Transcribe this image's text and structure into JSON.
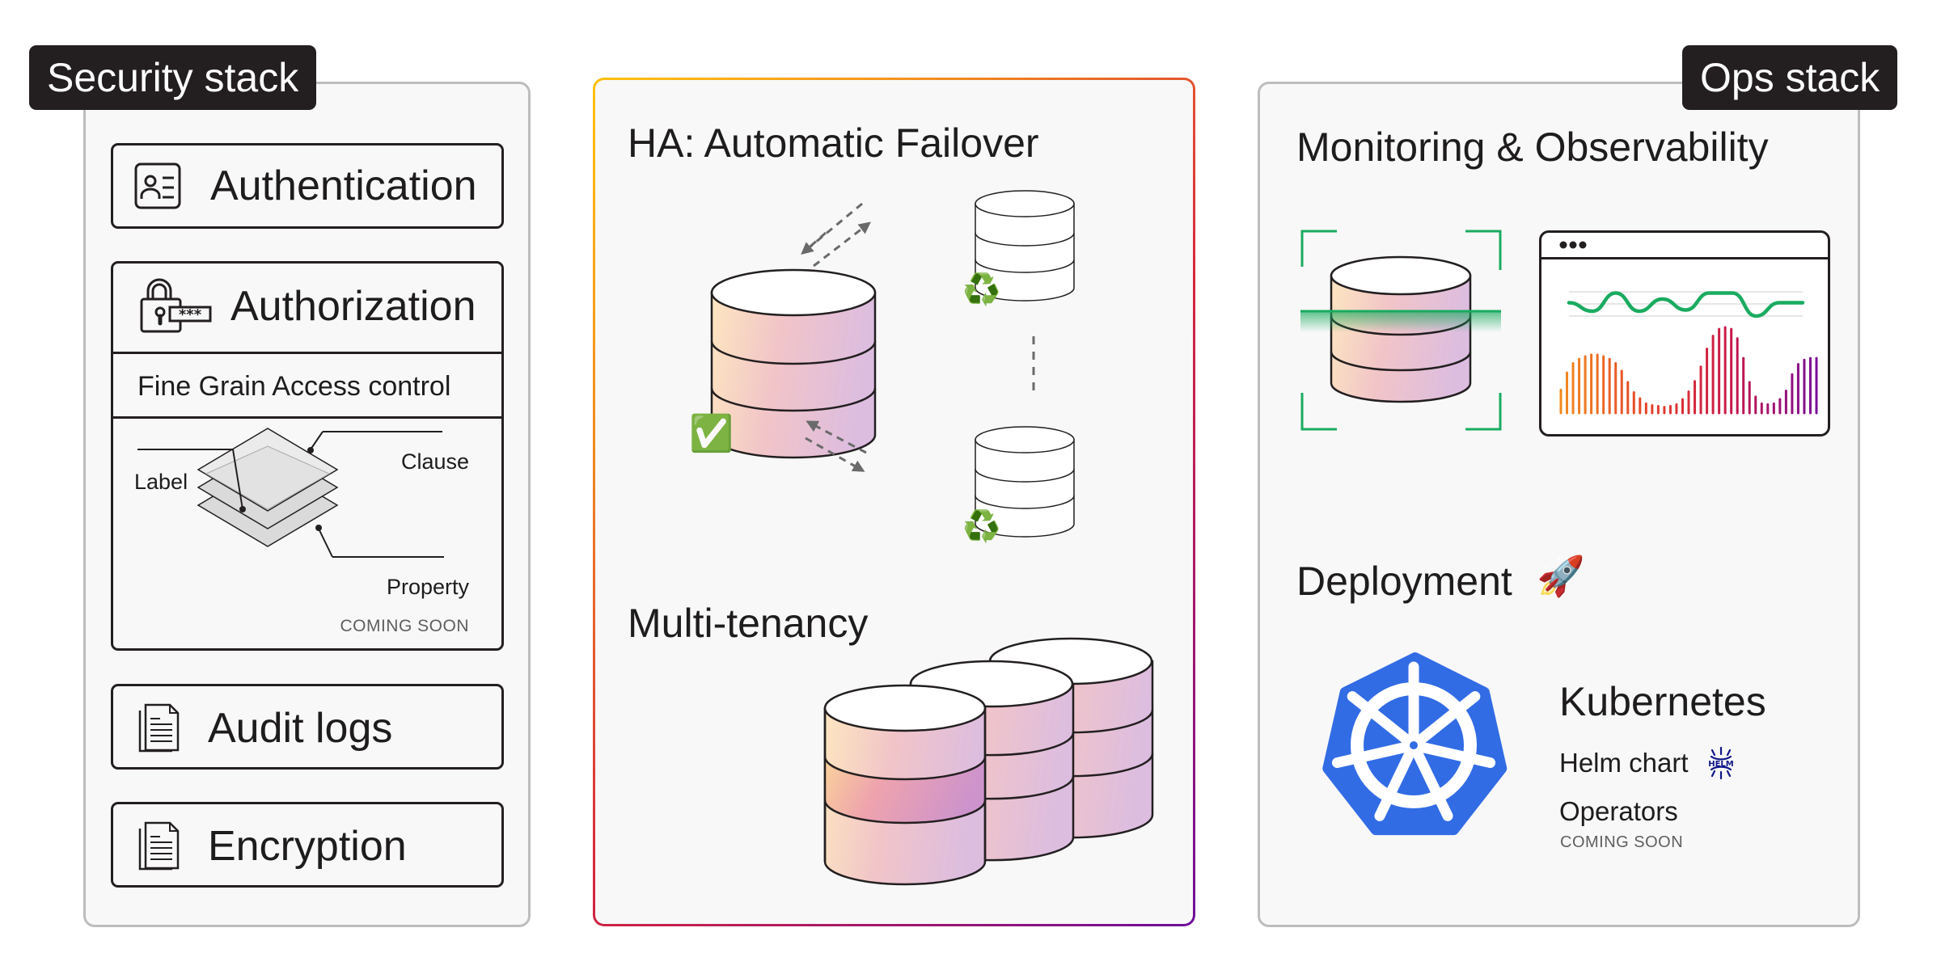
{
  "security": {
    "badge": "Security stack",
    "items": {
      "authentication": "Authentication",
      "authorization": "Authorization",
      "fine_grain": "Fine Grain Access control",
      "audit_logs": "Audit logs",
      "encryption": "Encryption"
    },
    "diagram": {
      "label": "Label",
      "clause": "Clause",
      "property": "Property",
      "coming_soon": "COMING SOON"
    },
    "icons": {
      "authentication": "id-card-icon",
      "authorization": "padlock-password-icon",
      "audit_logs": "documents-icon",
      "encryption": "documents-icon"
    }
  },
  "middle": {
    "ha_title": "HA: Automatic Failover",
    "multitenancy_title": "Multi-tenancy",
    "primary_status_icon": "✅",
    "replica_status_icon": "♻️",
    "gradient_colors": [
      "#ffc20e",
      "#f28a1e",
      "#d7263d",
      "#a0166e",
      "#6f0f9a"
    ]
  },
  "ops": {
    "badge": "Ops stack",
    "monitoring_title": "Monitoring & Observability",
    "deployment_title": "Deployment",
    "deployment_icon": "🚀",
    "kubernetes": "Kubernetes",
    "helm_chart": "Helm chart",
    "helm_logo_text": "HELM",
    "operators": "Operators",
    "operators_status": "COMING SOON",
    "colors": {
      "scan_green": "#1aab60",
      "kubernetes_blue": "#326ce5",
      "helm_navy": "#0f1689"
    },
    "dashboard": {
      "line_values": [
        0.55,
        0.2,
        0.95,
        0.2,
        0.7,
        0.25,
        0.95,
        0.95,
        0.0,
        0.55,
        0.55
      ],
      "bar_values": [
        0.27,
        0.47,
        0.58,
        0.63,
        0.66,
        0.68,
        0.68,
        0.66,
        0.63,
        0.58,
        0.49,
        0.36,
        0.24,
        0.17,
        0.11,
        0.09,
        0.08,
        0.07,
        0.08,
        0.1,
        0.16,
        0.25,
        0.37,
        0.54,
        0.75,
        0.9,
        0.98,
        1.0,
        0.98,
        0.87,
        0.64,
        0.36,
        0.19,
        0.11,
        0.1,
        0.11,
        0.16,
        0.26,
        0.45,
        0.57,
        0.62,
        0.64,
        0.64
      ]
    }
  }
}
